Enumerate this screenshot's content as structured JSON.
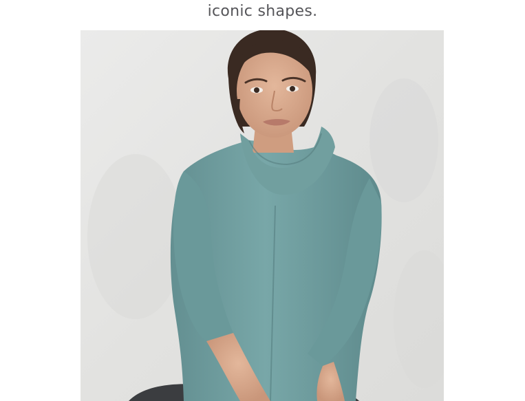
{
  "section": {
    "heading": "iconic shapes."
  },
  "product_photo": {
    "subject": "model-in-teal-cowlneck-sweater",
    "colors": {
      "background": "#e4e4e2",
      "sweater": "#6f9fa0",
      "skin": "#d7a98c",
      "hair": "#3a2a22",
      "pants": "#3b3d40"
    }
  }
}
